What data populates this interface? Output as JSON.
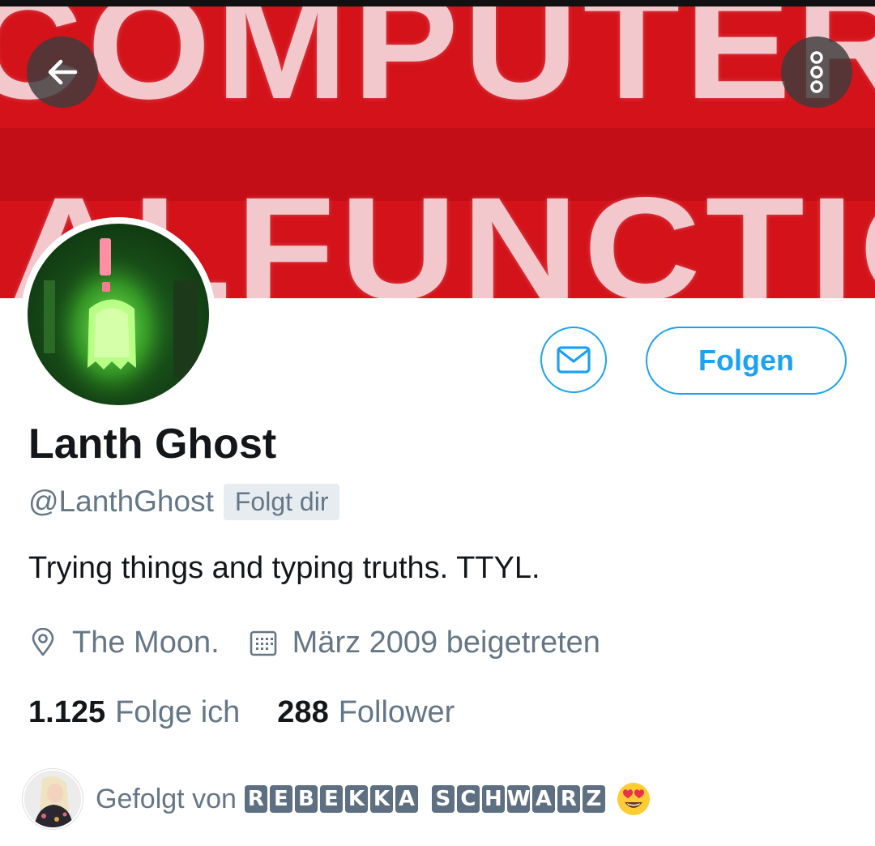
{
  "banner": {
    "text_top": "COMPUTER",
    "text_bottom": "MALFUNCTION"
  },
  "header": {
    "back_icon": "arrow-left-icon",
    "more_icon": "more-vertical-icon"
  },
  "profile": {
    "name": "Lanth Ghost",
    "handle": "@LanthGhost",
    "follows_you": "Folgt dir",
    "bio": "Trying things and typing truths. TTYL.",
    "location": "The Moon.",
    "joined": "März 2009 beigetreten"
  },
  "actions": {
    "message_icon": "mail-icon",
    "follow_label": "Folgen"
  },
  "stats": {
    "following_count": "1.125",
    "following_label": "Folge ich",
    "followers_count": "288",
    "followers_label": "Follower"
  },
  "followed_by": {
    "label": "Gefolgt von",
    "name_first": [
      "R",
      "E",
      "B",
      "E",
      "K",
      "K",
      "A"
    ],
    "name_last": [
      "S",
      "C",
      "H",
      "W",
      "A",
      "R",
      "Z"
    ],
    "emoji": "smiling-face-with-heart-eyes"
  },
  "colors": {
    "accent": "#1da1f2",
    "secondary_text": "#657786",
    "banner_red": "#d3121a"
  }
}
